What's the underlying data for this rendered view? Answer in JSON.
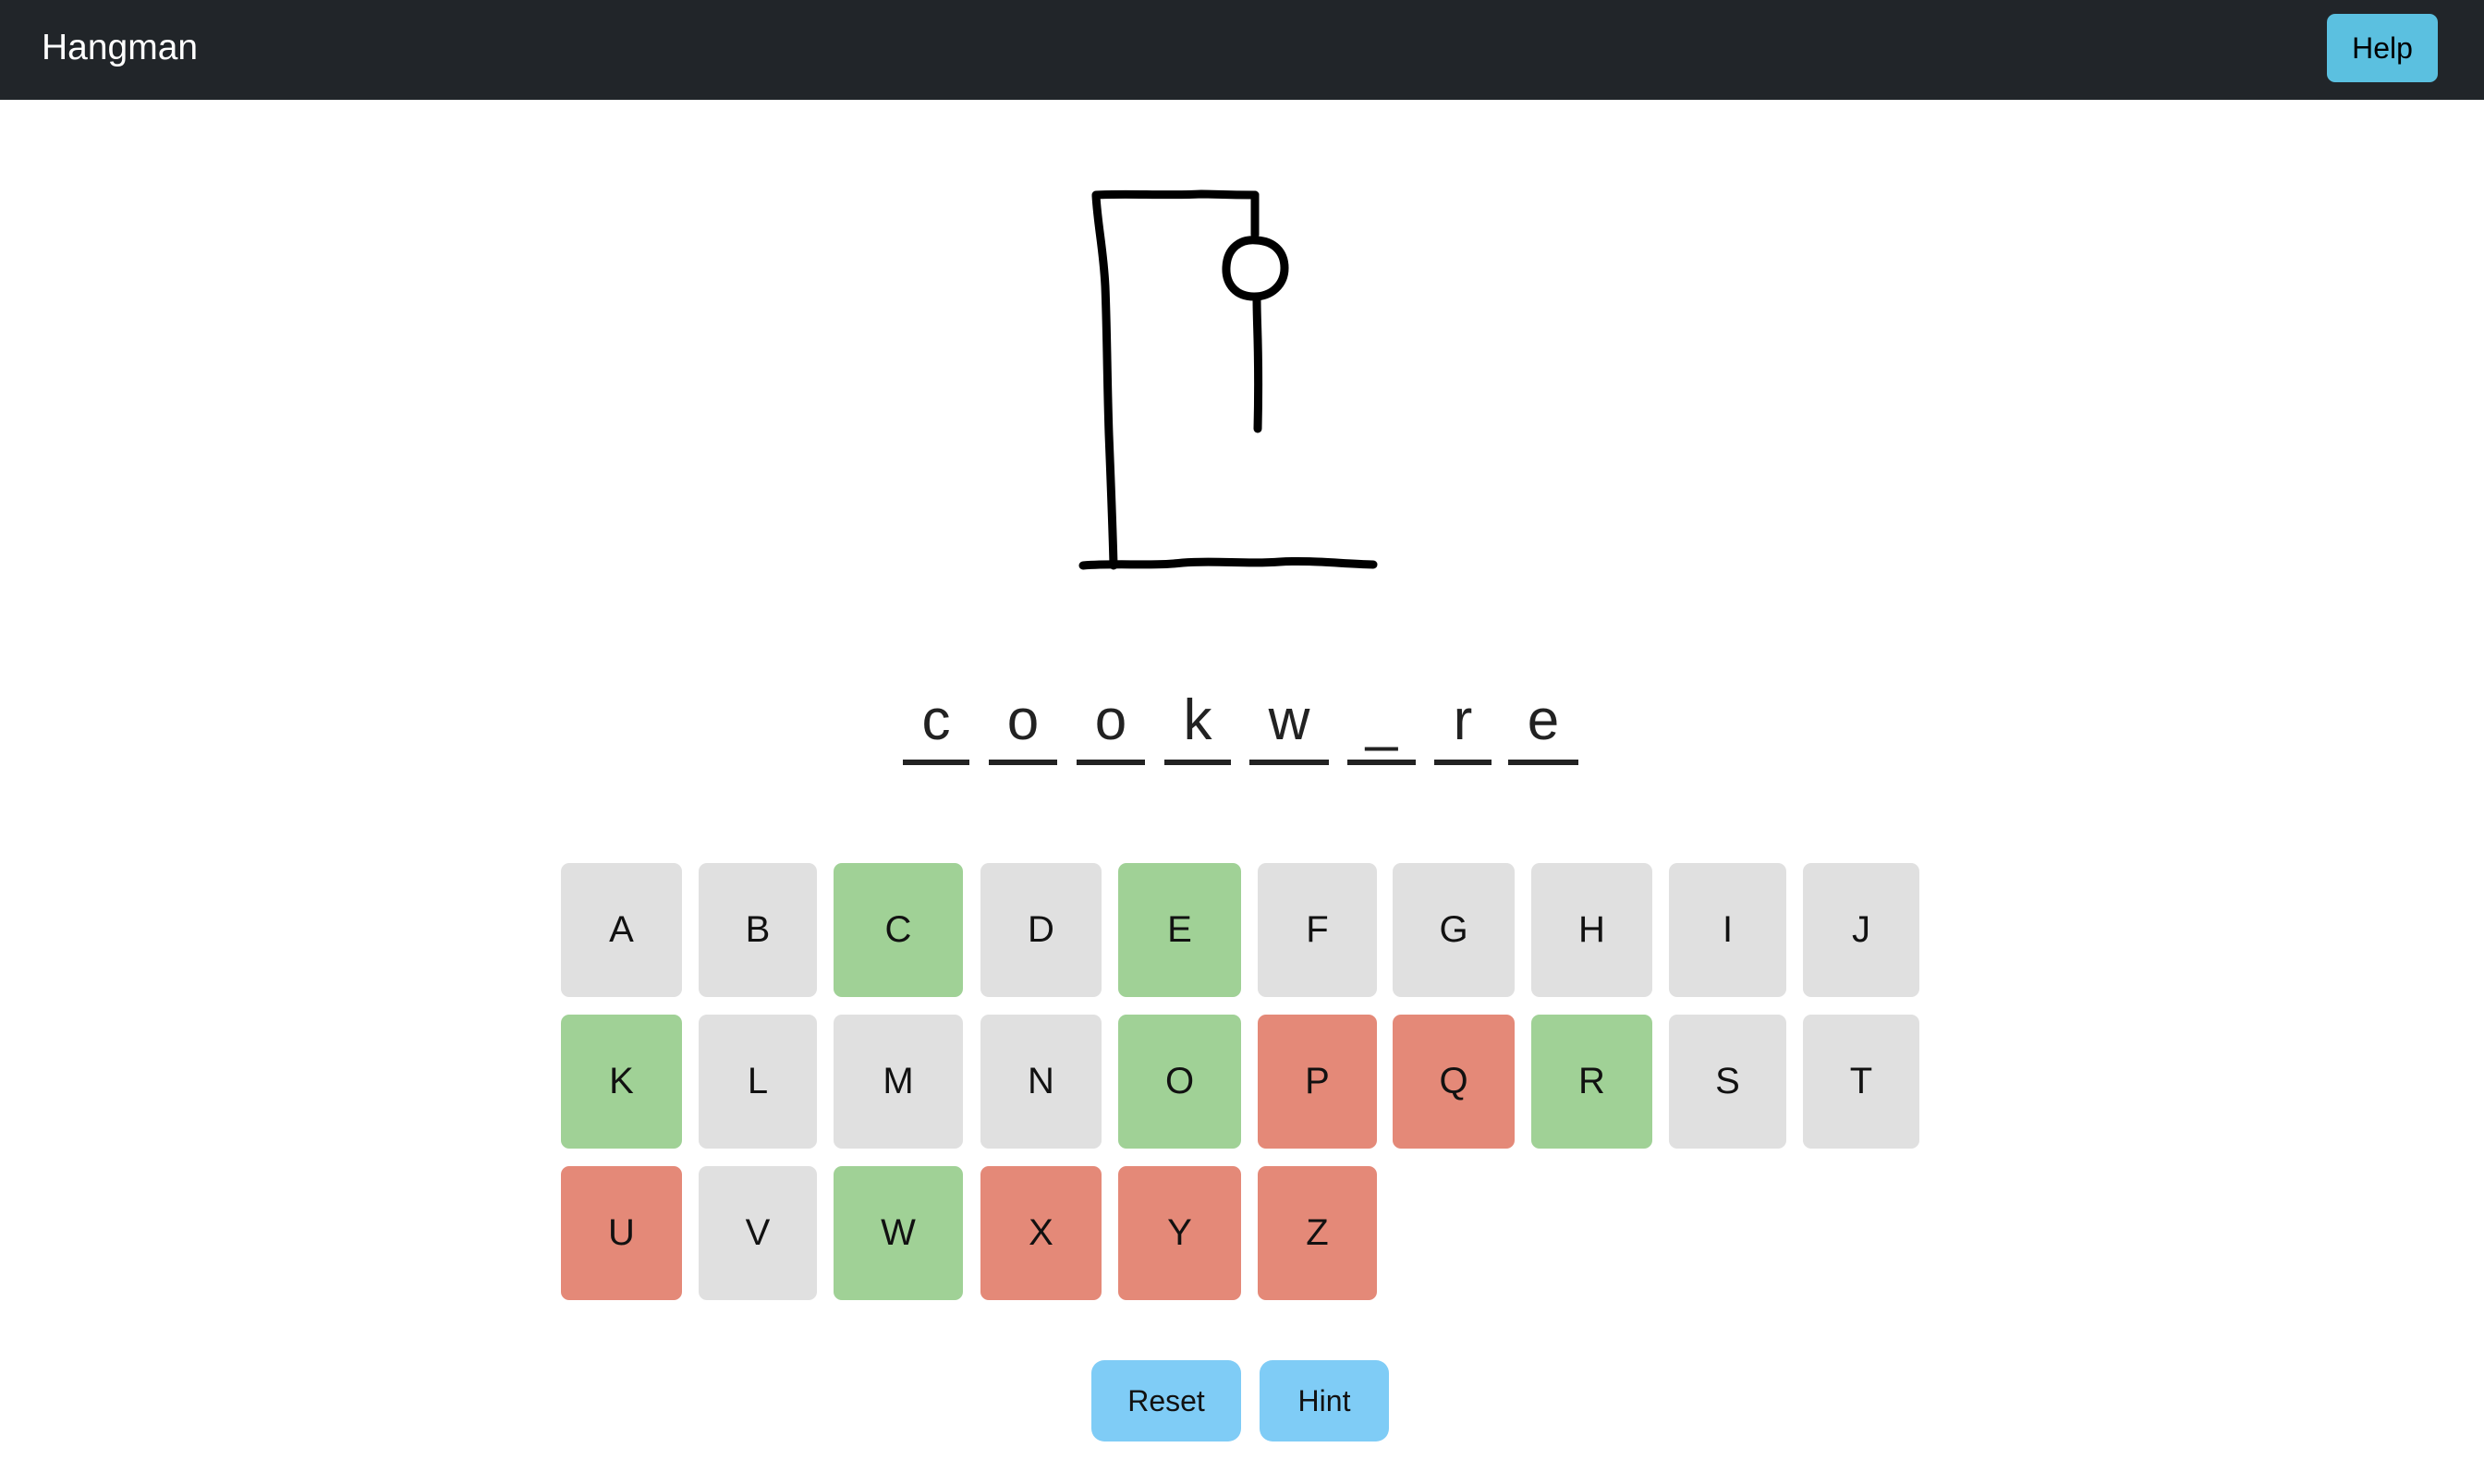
{
  "navbar": {
    "brand": "Hangman",
    "help_label": "Help"
  },
  "game": {
    "wrong_guesses": 6,
    "word_display": [
      "c",
      "o",
      "o",
      "k",
      "w",
      "_",
      "r",
      "e"
    ]
  },
  "keyboard": {
    "rows": [
      [
        {
          "letter": "A",
          "state": "unused"
        },
        {
          "letter": "B",
          "state": "unused"
        },
        {
          "letter": "C",
          "state": "correct"
        },
        {
          "letter": "D",
          "state": "unused"
        },
        {
          "letter": "E",
          "state": "correct"
        },
        {
          "letter": "F",
          "state": "unused"
        },
        {
          "letter": "G",
          "state": "unused"
        },
        {
          "letter": "H",
          "state": "unused"
        },
        {
          "letter": "I",
          "state": "unused"
        },
        {
          "letter": "J",
          "state": "unused"
        }
      ],
      [
        {
          "letter": "K",
          "state": "correct"
        },
        {
          "letter": "L",
          "state": "unused"
        },
        {
          "letter": "M",
          "state": "unused"
        },
        {
          "letter": "N",
          "state": "unused"
        },
        {
          "letter": "O",
          "state": "correct"
        },
        {
          "letter": "P",
          "state": "wrong"
        },
        {
          "letter": "Q",
          "state": "wrong"
        },
        {
          "letter": "R",
          "state": "correct"
        },
        {
          "letter": "S",
          "state": "unused"
        },
        {
          "letter": "T",
          "state": "unused"
        }
      ],
      [
        {
          "letter": "U",
          "state": "wrong"
        },
        {
          "letter": "V",
          "state": "unused"
        },
        {
          "letter": "W",
          "state": "correct"
        },
        {
          "letter": "X",
          "state": "wrong"
        },
        {
          "letter": "Y",
          "state": "wrong"
        },
        {
          "letter": "Z",
          "state": "wrong"
        }
      ]
    ],
    "colors": {
      "unused": "#e0e0e0",
      "correct": "#a0d196",
      "wrong": "#e48978"
    }
  },
  "actions": {
    "reset_label": "Reset",
    "hint_label": "Hint"
  }
}
